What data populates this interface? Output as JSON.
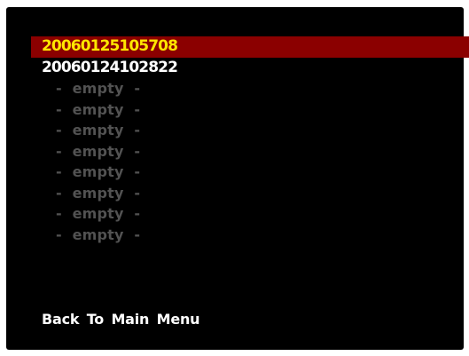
{
  "menu": {
    "slots": [
      {
        "label": "20060125105708",
        "state": "selected"
      },
      {
        "label": "20060124102822",
        "state": "filled"
      },
      {
        "label": "- empty -",
        "state": "empty"
      },
      {
        "label": "- empty -",
        "state": "empty"
      },
      {
        "label": "- empty -",
        "state": "empty"
      },
      {
        "label": "- empty -",
        "state": "empty"
      },
      {
        "label": "- empty -",
        "state": "empty"
      },
      {
        "label": "- empty -",
        "state": "empty"
      },
      {
        "label": "- empty -",
        "state": "empty"
      },
      {
        "label": "- empty -",
        "state": "empty"
      }
    ],
    "back_label": "Back To Main Menu"
  },
  "colors": {
    "background": "#000000",
    "highlight_bar": "#8b0000",
    "highlight_text": "#ffe600",
    "text": "#ffffff",
    "disabled_text": "#525252"
  }
}
